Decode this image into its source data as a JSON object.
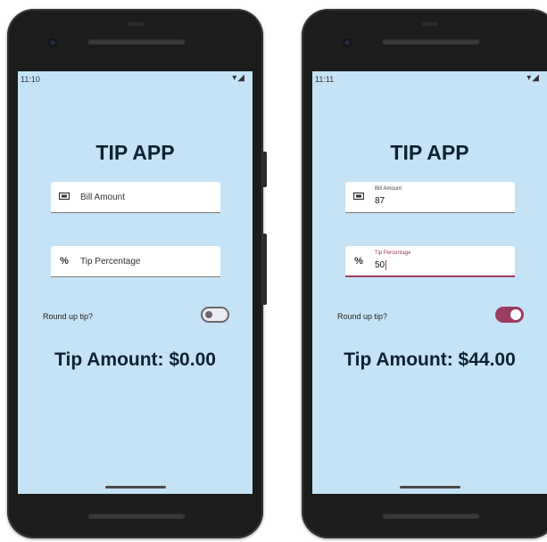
{
  "screens": [
    {
      "id": "left",
      "status_time": "11:10",
      "status_icons": "▾◢",
      "title": "TIP APP",
      "bill_field": {
        "label": "Bill Amount",
        "value": "",
        "icon": "bill-icon"
      },
      "tip_field": {
        "label": "Tip Percentage",
        "value": "",
        "icon": "percent-icon",
        "icon_glyph": "%"
      },
      "round_label": "Round up tip?",
      "round_up_on": false,
      "tip_amount": "Tip Amount: $0.00"
    },
    {
      "id": "right",
      "status_time": "11:11",
      "status_icons": "▾◢",
      "title": "TIP APP",
      "bill_field": {
        "label": "Bill Amount",
        "value": "87",
        "icon": "bill-icon"
      },
      "tip_field": {
        "label": "Tip Percentage",
        "value": "50",
        "icon": "percent-icon",
        "icon_glyph": "%"
      },
      "round_label": "Round up tip?",
      "round_up_on": true,
      "tip_amount": "Tip Amount: $44.00"
    }
  ],
  "colors": {
    "screen_bg": "#c4e3f6",
    "accent": "#9b3c63",
    "text_dark": "#0e2233"
  }
}
